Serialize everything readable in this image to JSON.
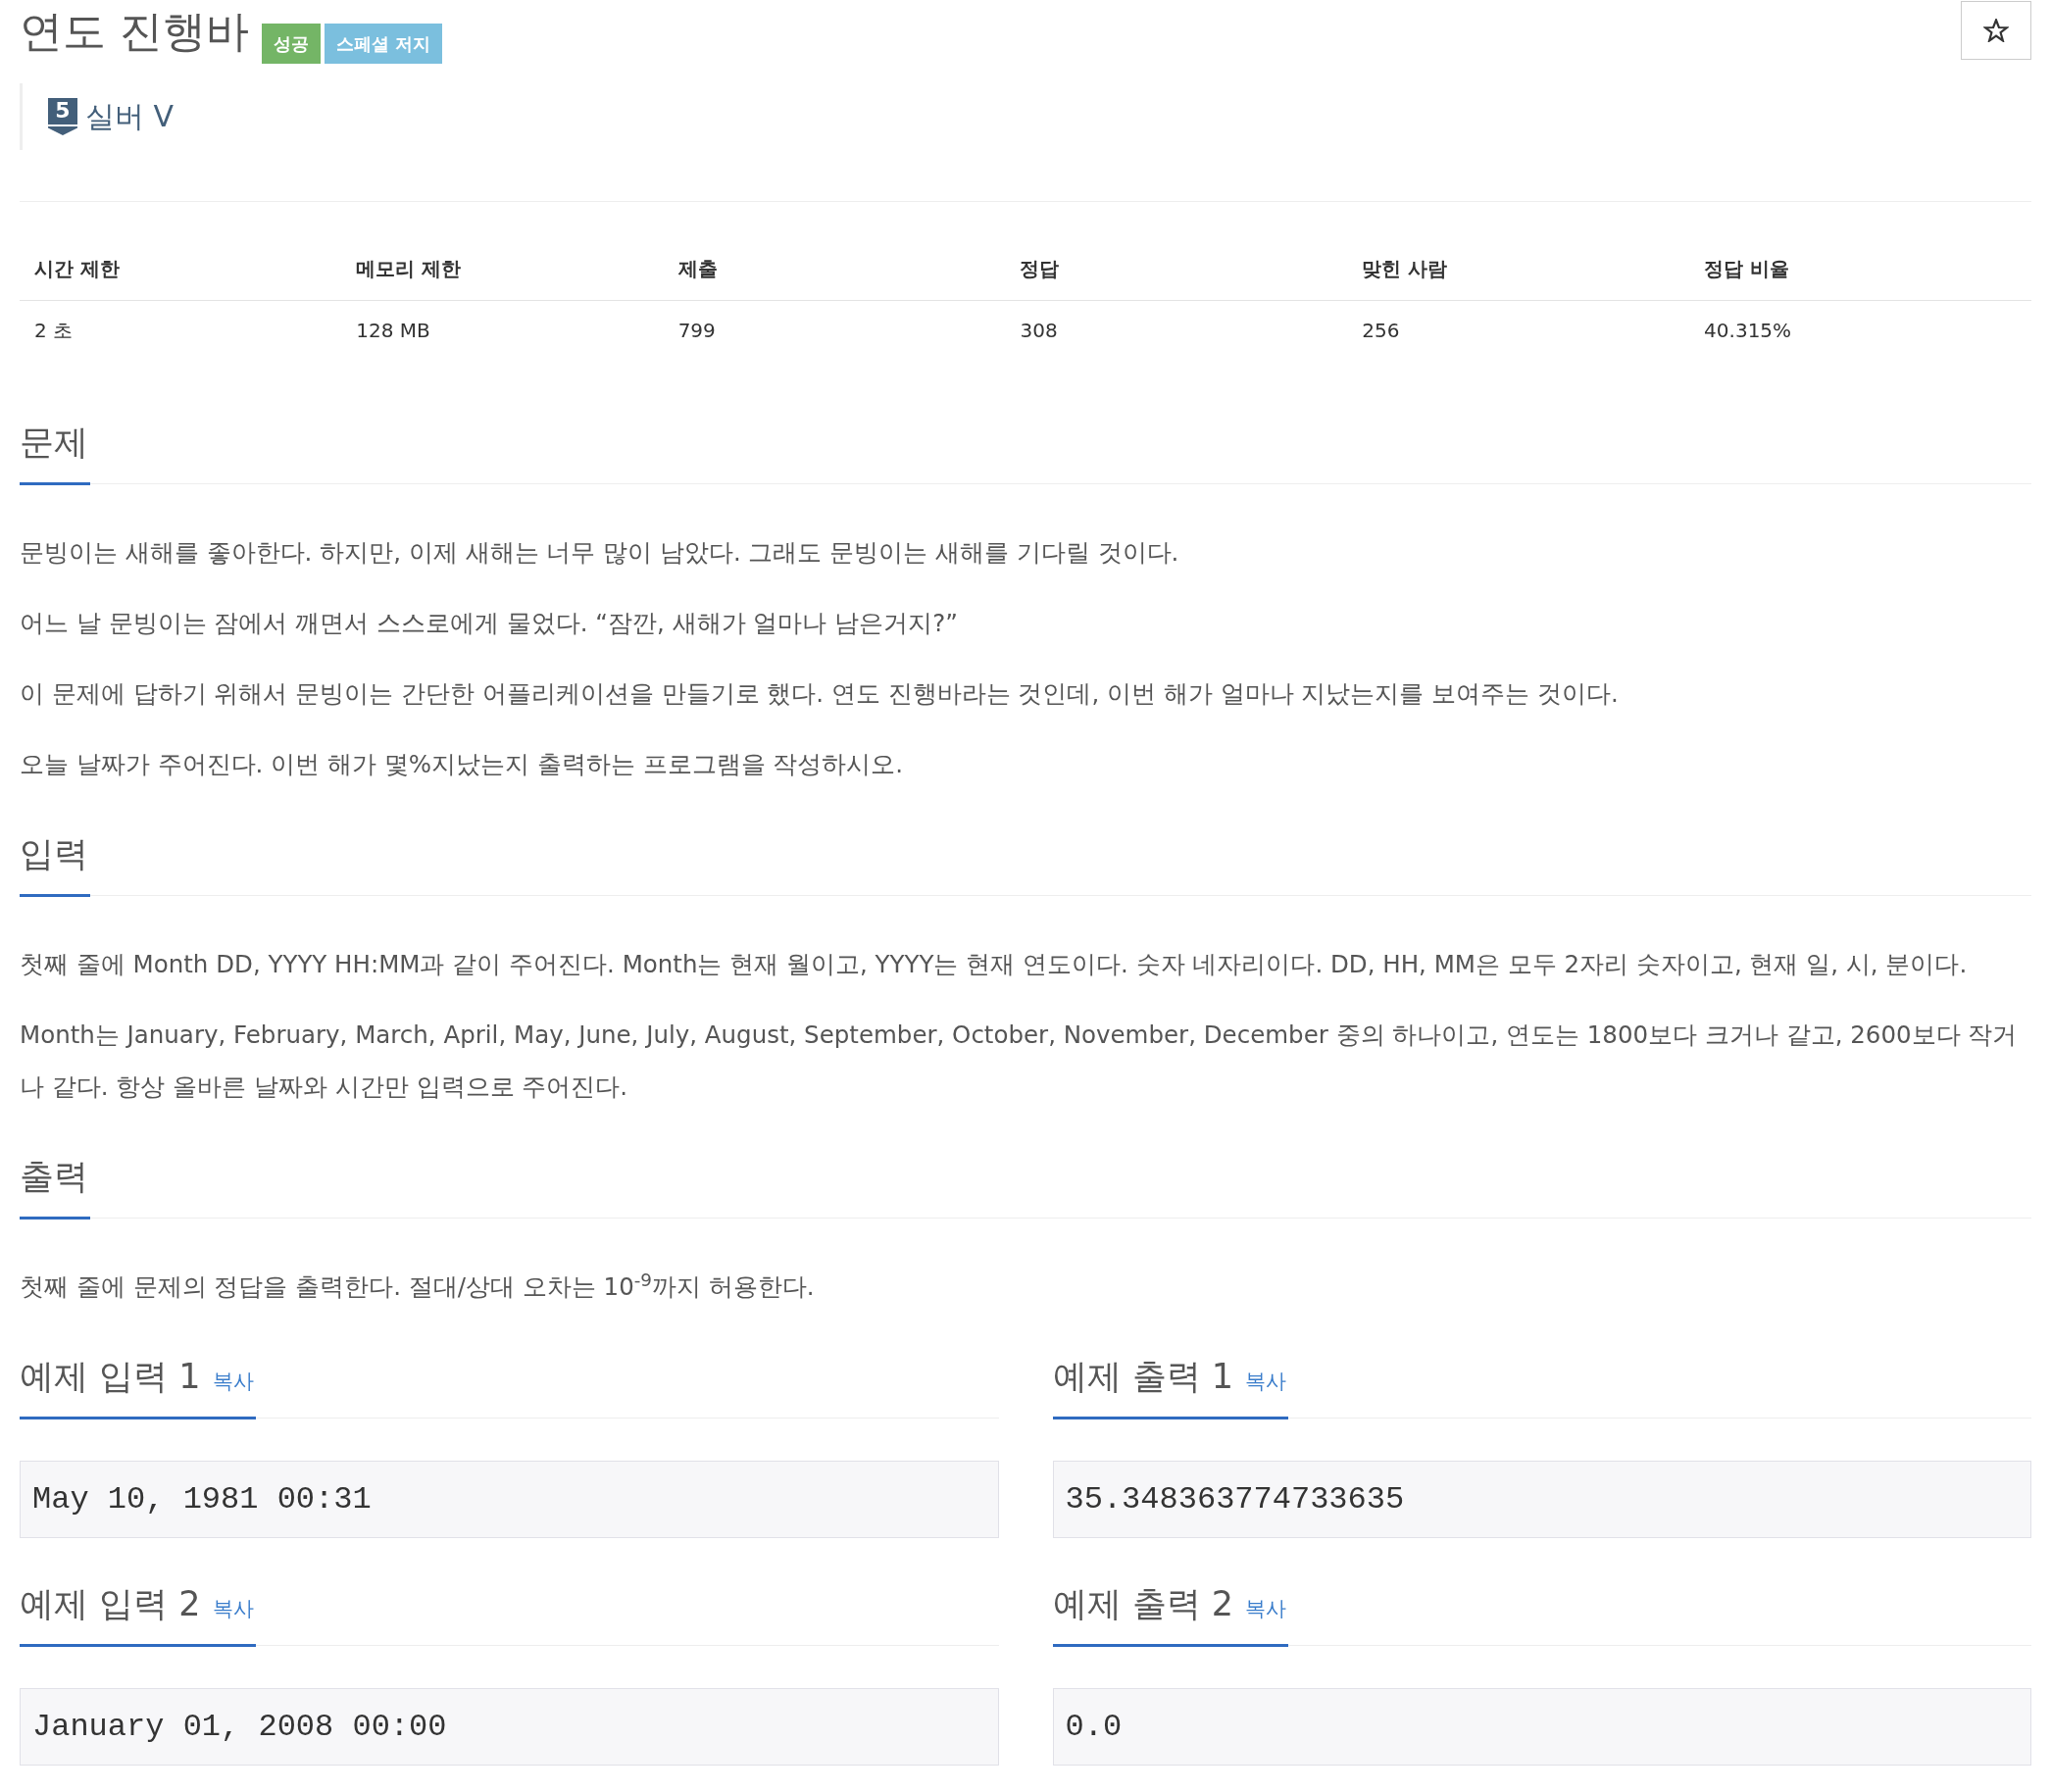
{
  "title": "연도 진행바",
  "badges": [
    {
      "text": "성공",
      "kind": "success"
    },
    {
      "text": "스페셜 저지",
      "kind": "info"
    }
  ],
  "star_button": {
    "starred": false
  },
  "tier": {
    "digit": "5",
    "name": "실버 V"
  },
  "stats": {
    "columns": [
      "시간 제한",
      "메모리 제한",
      "제출",
      "정답",
      "맞힌 사람",
      "정답 비율"
    ],
    "rows": [
      [
        "2 초",
        "128 MB",
        "799",
        "308",
        "256",
        "40.315%"
      ]
    ]
  },
  "sections": [
    {
      "heading": "문제",
      "paragraphs": [
        "문빙이는 새해를 좋아한다. 하지만, 이제 새해는 너무 많이 남았다. 그래도 문빙이는 새해를 기다릴 것이다.",
        "어느 날 문빙이는 잠에서 깨면서 스스로에게 물었다. “잠깐, 새해가 얼마나 남은거지?”",
        "이 문제에 답하기 위해서 문빙이는 간단한 어플리케이션을 만들기로 했다. 연도 진행바라는 것인데, 이번 해가 얼마나 지났는지를 보여주는 것이다.",
        "오늘 날짜가 주어진다. 이번 해가 몇%지났는지 출력하는 프로그램을 작성하시오."
      ]
    },
    {
      "heading": "입력",
      "paragraphs": [
        "첫째 줄에 Month DD, YYYY HH:MM과 같이 주어진다. Month는 현재 월이고, YYYY는 현재 연도이다. 숫자 네자리이다. DD, HH, MM은 모두 2자리 숫자이고, 현재 일, 시, 분이다.",
        "Month는 January, February, March, April, May, June, July, August, September, October, November, December 중의 하나이고, 연도는 1800보다 크거나 같고, 2600보다 작거나 같다. 항상 올바른 날짜와 시간만 입력으로 주어진다."
      ]
    },
    {
      "heading": "출력",
      "paragraphs": [
        "첫째 줄에 문제의 정답을 출력한다. 절대/상대 오차는 10$^{-9}$까지 허용한다."
      ]
    }
  ],
  "examples": [
    {
      "heading": "예제 입력 1",
      "copy_link": "복사",
      "data": "May 10, 1981 00:31"
    },
    {
      "heading": "예제 출력 1",
      "copy_link": "복사",
      "data": "35.348363774733635"
    },
    {
      "heading": "예제 입력 2",
      "copy_link": "복사",
      "data": "January 01, 2008 00:00"
    },
    {
      "heading": "예제 출력 2",
      "copy_link": "복사",
      "data": "0.0"
    }
  ]
}
